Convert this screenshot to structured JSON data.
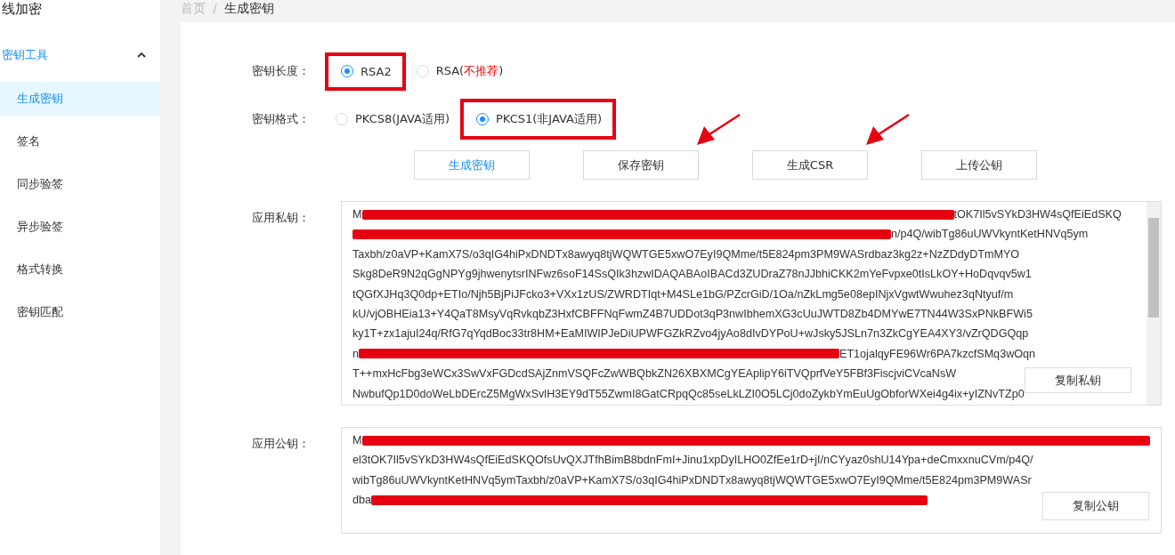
{
  "sidebar": {
    "title": "线加密",
    "groups": [
      {
        "label": "密钥工具",
        "expanded": true,
        "items": [
          {
            "label": "生成密钥",
            "selected": true
          },
          {
            "label": "签名",
            "selected": false
          },
          {
            "label": "同步验签",
            "selected": false
          },
          {
            "label": "异步验签",
            "selected": false
          },
          {
            "label": "格式转换",
            "selected": false
          },
          {
            "label": "密钥匹配",
            "selected": false
          }
        ]
      }
    ]
  },
  "breadcrumb_separator": "/",
  "breadcrumb": [
    {
      "label": "首页",
      "current": false
    },
    {
      "label": "生成密钥",
      "current": true
    }
  ],
  "form": {
    "fields": [
      {
        "label": "密钥长度：",
        "options": [
          {
            "label": "RSA2",
            "selected": true,
            "annotated": true
          },
          {
            "label": "RSA(**不推荐**)",
            "selected": false,
            "annotated": false
          }
        ]
      },
      {
        "label": "密钥格式：",
        "options": [
          {
            "label": "PKCS8(JAVA适用)",
            "selected": false,
            "annotated": false
          },
          {
            "label": "PKCS1(非JAVA适用)",
            "selected": true,
            "annotated": true
          }
        ]
      }
    ],
    "buttons": [
      {
        "label": "生成密钥",
        "primary": true,
        "annotated": false
      },
      {
        "label": "保存密钥",
        "primary": false,
        "annotated": true
      },
      {
        "label": "生成CSR",
        "primary": false,
        "annotated": true
      },
      {
        "label": "上传公钥",
        "primary": false,
        "annotated": false
      }
    ],
    "keys": [
      {
        "label": "应用私钥：",
        "copy_button": "复制私钥",
        "scrollbar": true,
        "lines": [
          {
            "kind": "redacted",
            "head": "M",
            "tail": "tOK7Il5vSYkD3HW4sQfEiEdSKQ"
          },
          {
            "kind": "redacted",
            "tail": "n/p4Q/wibTg86uUWVkyntKetHNVq5ym"
          },
          {
            "kind": "text",
            "text": "Taxbh/z0aVP+KamX7S/o3qIG4hiPxDNDTx8awyq8tjWQWTGE5xwO7EyI9QMme/t5E824pm3PM9WASrdbaz3kg2z+NzZDdyDTmMYO"
          },
          {
            "kind": "text",
            "text": "Skg8DeR9N2qGgNPYg9jhwenytsrINFwz6soF14SsQIk3hzwIDAQABAoIBACd3ZUDraZ78nJJbhiCKK2mYeFvpxe0tIsLkOY+HoDqvqv5w1"
          },
          {
            "kind": "text",
            "text": "tQGfXJHq3Q0dp+ETIo/Njh5BjPiJFcko3+VXx1zUS/ZWRDTIqt+M4SLe1bG/PZcrGiD/1Oa/nZkLmg5e08epINjxVgwtWwuhez3qNtyuf/m"
          },
          {
            "kind": "text",
            "text": "kU/vjOBHEia13+Y4QaT8MsyVqRvkqbZ3HxfCBFFNqFwmZ4B7UDDot3qP3nwIbhemXG3cUuJWTD8Zb4DMYwE7TN44W3SxPNkBFWi5"
          },
          {
            "kind": "text",
            "text": "ky1T+zx1ajuI24q/RfG7qYqdBoc33tr8HM+EaMIWIPJeDiUPWFGZkRZvo4jyAo8dIvDYPoU+wJsky5JSLn7n3ZkCgYEA4XY3/vZrQDGQqp"
          },
          {
            "kind": "redacted",
            "head": "n",
            "tail": "ET1ojalqyFE96Wr6PA7kzcfSMq3wOqn"
          },
          {
            "kind": "text",
            "text": "T++mxHcFbg3eWCx3SwVxFGDcdSAjZnmVSQFcZwWBQbkZN26XBXMCgYEAplipY6iTVQprfVeY5FBf3FiscjviCVcaNsW"
          },
          {
            "kind": "text",
            "text": "NwbufQp1D0doWeLbDErcZ5MgWxSvlH3EY9dT55ZwmI8GatCRpqQc85seLkLZI0O5LCj0doZykbYmEuUgObforWXei4g4ix+yIZNvTZp0"
          }
        ]
      },
      {
        "label": "应用公钥：",
        "copy_button": "复制公钥",
        "scrollbar": false,
        "lines": [
          {
            "kind": "redacted",
            "head": "M"
          },
          {
            "kind": "text",
            "text": "el3tOK7Il5vSYkD3HW4sQfEiEdSKQOfsUvQXJTfhBimB8bdnFmI+Jinu1xpDyILHO0ZfEe1rD+jI/nCYyaz0shU14Ypa+deCmxxnuCVm/p4Q/"
          },
          {
            "kind": "text",
            "text": "wibTg86uUWVkyntKetHNVq5ymTaxbh/z0aVP+KamX7S/o3qIG4hiPxDNDTx8awyq8tjWQWTGE5xwO7EyI9QMme/t5E824pm3PM9WASr"
          },
          {
            "kind": "redacted",
            "head": "dba"
          }
        ]
      }
    ]
  }
}
